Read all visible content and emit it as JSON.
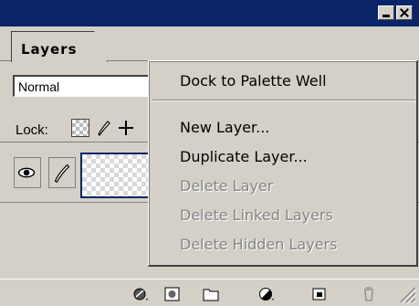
{
  "palette": {
    "tab_label": "Layers",
    "blend_mode": "Normal",
    "lock_label": "Lock:"
  },
  "context_menu": {
    "items": [
      {
        "label": "Dock to Palette Well",
        "enabled": true
      },
      {
        "label": "New Layer...",
        "enabled": true
      },
      {
        "label": "Duplicate Layer...",
        "enabled": true
      },
      {
        "label": "Delete Layer",
        "enabled": false
      },
      {
        "label": "Delete Linked Layers",
        "enabled": false
      },
      {
        "label": "Delete Hidden Layers",
        "enabled": false
      }
    ]
  },
  "colors": {
    "title_bar": "#0a246a",
    "face": "#d4d0c8",
    "disabled_text": "#848484"
  },
  "icons": [
    "minimize-icon",
    "close-icon",
    "palette-menu-arrow-icon",
    "lock-transparency-icon",
    "lock-paint-icon",
    "lock-move-icon",
    "eye-icon",
    "brush-icon",
    "layer-style-icon",
    "layer-mask-icon",
    "layer-set-icon",
    "adjustment-layer-icon",
    "new-layer-icon",
    "trash-icon"
  ]
}
